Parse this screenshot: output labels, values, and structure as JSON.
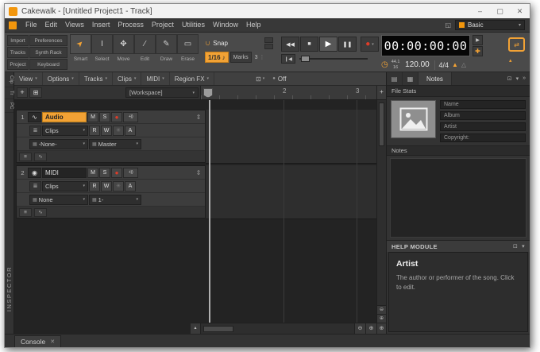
{
  "ui": {
    "arrow_down": "▾"
  },
  "window": {
    "title": "Cakewalk - [Untitled Project1 - Track]",
    "minimize": "–",
    "maximize": "▢",
    "close": "✕"
  },
  "menubar": {
    "items": [
      "File",
      "Edit",
      "Views",
      "Insert",
      "Process",
      "Project",
      "Utilities",
      "Window",
      "Help"
    ],
    "screenset_icon": "◱",
    "workspace": {
      "label": "Basic"
    }
  },
  "modulebar": {
    "nav_buttons": [
      "Import",
      "Preferences",
      "Tracks",
      "Synth Rack",
      "Project",
      "Keyboard"
    ],
    "tools": [
      {
        "icon": "➤",
        "label": "Smart"
      },
      {
        "icon": "I",
        "label": "Select"
      },
      {
        "icon": "✥",
        "label": "Move"
      },
      {
        "icon": "∕",
        "label": "Edit"
      },
      {
        "icon": "✎",
        "label": "Draw"
      },
      {
        "icon": "▭",
        "label": "Erase"
      }
    ],
    "snap": {
      "magnet_icon": "∩",
      "label": "Snap",
      "resolution": "1/16",
      "note_icon": "♪",
      "marks": "Marks",
      "count": "3",
      "dots": "⋮"
    },
    "transport": {
      "rewind": "◀◀",
      "stop": "■",
      "play": "▶",
      "pause": "❚❚",
      "record": "●",
      "rtz": "❙◀"
    },
    "time_display": "00:00:00:00",
    "time_buttons": {
      "marker": "▶",
      "add": "✚"
    },
    "tempo": {
      "clock_icon": "◷",
      "sample_rate": "44.1",
      "bit_depth": "16",
      "bpm": "120.00",
      "time_signature": "4/4",
      "metronome_icon": "▲",
      "metronome_icon2": "△"
    },
    "loop": {
      "icon": "⇄",
      "tri": "▴"
    }
  },
  "trackview": {
    "menus": [
      "View",
      "Options",
      "Tracks",
      "Clips",
      "MIDI",
      "Region FX"
    ],
    "aim_icon": "⊡",
    "off_dot": "●",
    "off_label": "Off",
    "add_track": "+",
    "track_manager": "⊞",
    "workspace_dropdown": {
      "label": "[Workspace]"
    },
    "ruler": {
      "bar2": "2",
      "bar3": "3",
      "add": "+"
    },
    "tracks": [
      {
        "num": "1",
        "type_icon": "∿",
        "name": "Audio",
        "mute": "M",
        "solo": "S",
        "arm": "●",
        "monitor": "+))",
        "expand": "⇕",
        "filter_icon": "≣",
        "clips": "Clips",
        "read": "R",
        "write": "W",
        "freeze": "✳",
        "automation": "A",
        "io_icon": "▦",
        "input": "-None-",
        "output": "Master",
        "strip1": "≡",
        "strip2": "∿"
      },
      {
        "num": "2",
        "type_icon": "◉",
        "name": "MIDI",
        "mute": "M",
        "solo": "S",
        "arm": "●",
        "monitor": "+))",
        "expand": "⇕",
        "filter_icon": "≣",
        "clips": "Clips",
        "read": "R",
        "write": "W",
        "freeze": "✳",
        "automation": "A",
        "io_icon": "▦",
        "input": "None",
        "output": "1-",
        "strip1": "≡",
        "strip2": "∿"
      }
    ],
    "scroll": {
      "collapse": "▴",
      "zoom_out": "⊖",
      "zoom_in": "⊕",
      "corner": "⊕",
      "vzoom1": "⊖",
      "vzoom2": "⊕"
    }
  },
  "inspector": {
    "tabs": [
      "Clip",
      "Tr",
      "PC"
    ],
    "label": "INSPECTOR"
  },
  "browser": {
    "tab_icons": [
      "▤",
      "▦"
    ],
    "notes_tab": "Notes",
    "header_icons": {
      "pin": "⊡",
      "collapse": "»"
    },
    "file_stats": "File Stats",
    "fields": [
      "Name",
      "Album",
      "Artist",
      "Copyright:"
    ],
    "notes_label": "Notes",
    "help": {
      "title": "HELP MODULE",
      "pin": "⊡",
      "heading": "Artist",
      "body": "The author or performer of the song. Click to edit."
    }
  },
  "statusbar": {
    "console_tab": "Console",
    "close": "✕"
  }
}
